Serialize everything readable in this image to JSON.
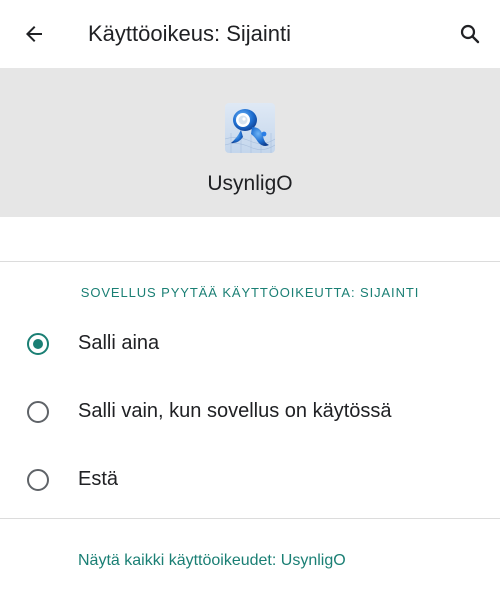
{
  "toolbar": {
    "back_icon": "arrow-back-icon",
    "title": "Käyttöoikeus: Sijainti",
    "search_icon": "search-icon"
  },
  "app": {
    "icon": "usynligo-app-icon",
    "name": "UsynligO"
  },
  "permission": {
    "section_header": "SOVELLUS PYYTÄÄ KÄYTTÖOIKEUTTA: SIJAINTI",
    "options": [
      {
        "label": "Salli aina",
        "selected": true
      },
      {
        "label": "Salli vain, kun sovellus on käytössä",
        "selected": false
      },
      {
        "label": "Estä",
        "selected": false
      }
    ]
  },
  "footer": {
    "link": "Näytä kaikki käyttöoikeudet: UsynligO"
  },
  "colors": {
    "accent": "#1a7f74",
    "header_background": "#e6e6e6",
    "text": "#202124",
    "icon": "#5f6368"
  }
}
